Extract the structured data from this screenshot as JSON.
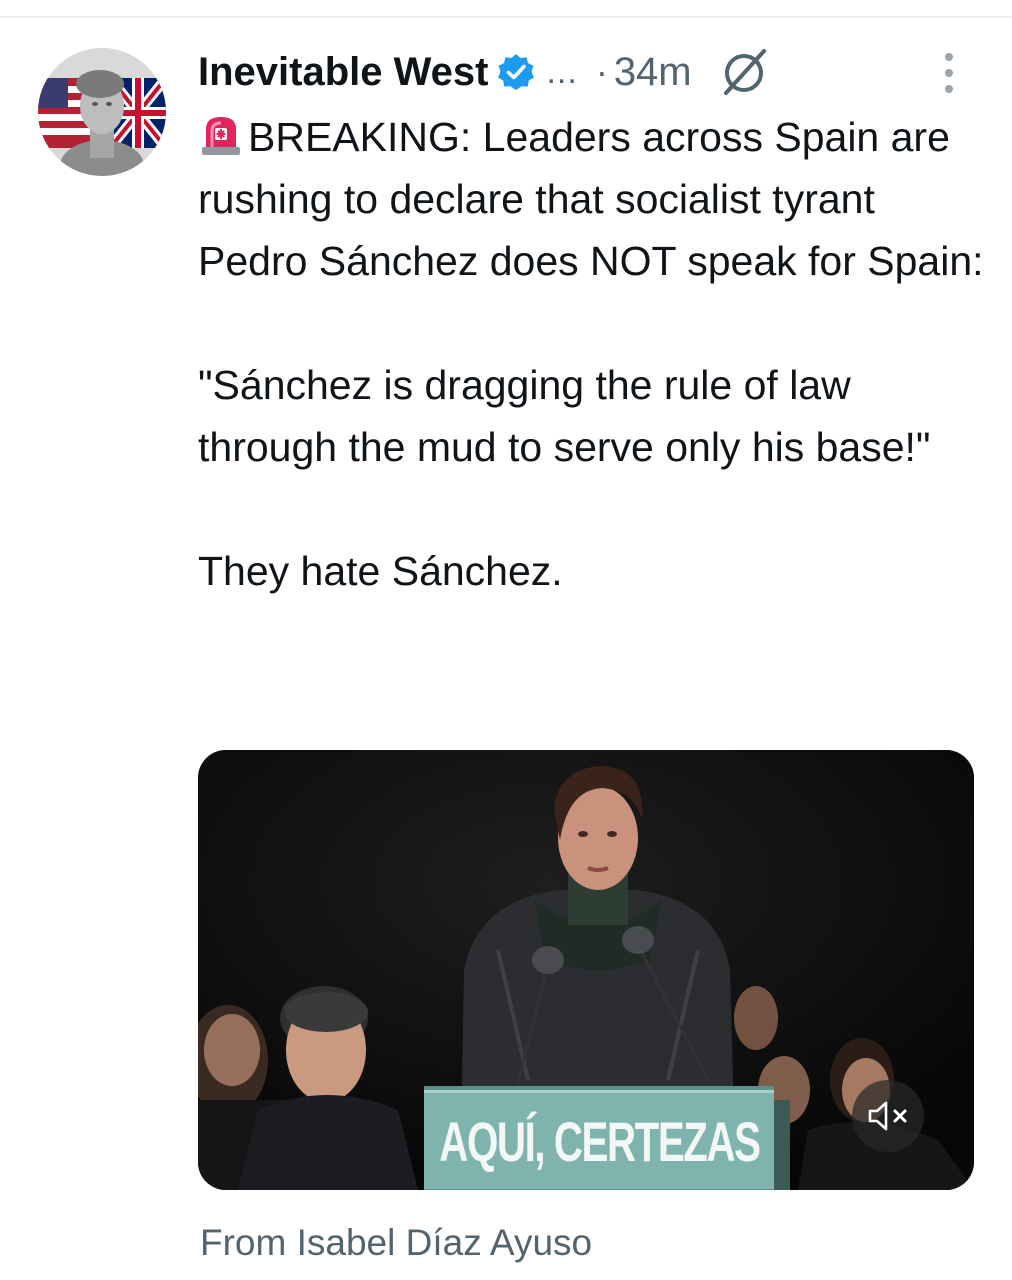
{
  "post": {
    "author": {
      "display_name": "Inevitable West",
      "verified": true,
      "avatar": "statue-head-flags-avatar"
    },
    "ellipsis": "...",
    "separator": "·",
    "timestamp": "34m",
    "text": {
      "emoji": "police-siren-icon",
      "paragraph_1": "BREAKING: Leaders across Spain are rushing to declare that socialist tyrant Pedro Sánchez does NOT speak for Spain:",
      "paragraph_2": "\"Sánchez is dragging the rule of law through the mud to serve only his base!\"",
      "paragraph_3": "They hate Sánchez."
    },
    "media": {
      "type": "video",
      "podium_sign": "AQUÍ, CERTEZAS",
      "muted": true,
      "podium_color": "#7fb3ad"
    },
    "source_label": "From Isabel Díaz Ayuso"
  },
  "colors": {
    "verified_blue": "#1d9bf0",
    "secondary_text": "#536471",
    "primary_text": "#0f1419"
  },
  "icons": [
    "verified-badge-icon",
    "grok-icon",
    "more-options-icon",
    "police-siren-icon",
    "mute-icon"
  ]
}
